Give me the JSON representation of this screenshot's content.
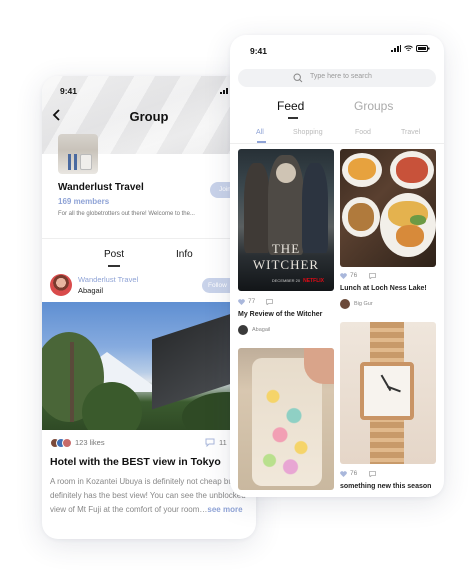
{
  "group_screen": {
    "status_time": "9:41",
    "title": "Group",
    "group_name": "Wanderlust Travel",
    "members": "169 members",
    "description": "For all the globetrotters out there! Welcome to the...",
    "join_label": "Join",
    "tabs": [
      {
        "label": "Post"
      },
      {
        "label": "Info"
      }
    ],
    "post": {
      "group": "Wanderlust Travel",
      "author": "Abagail",
      "follow_label": "Follow",
      "likes": "123 likes",
      "comments": "11",
      "title": "Hotel with the BEST view in Tokyo",
      "body": "A room in Kozantei Ubuya is definitely not cheap but it definitely has the best view! You can see the unblocked view of Mt Fuji at the comfort of your room…",
      "see_more": "see more"
    }
  },
  "feed_screen": {
    "status_time": "9:41",
    "search_placeholder": "Type here to search",
    "tabs": [
      {
        "label": "Feed"
      },
      {
        "label": "Groups"
      }
    ],
    "categories": [
      "All",
      "Shopping",
      "Food",
      "Travel"
    ],
    "cards": [
      {
        "likes": "77",
        "title": "My Review of the Witcher",
        "author": "Abagail",
        "image_text": "THE WITCHER",
        "image_subtext": "DECEMBER 20",
        "image_brand": "NETFLIX"
      },
      {
        "likes": "76",
        "title": "Lunch at Loch Ness Lake!",
        "author": "Big Gur"
      },
      {
        "likes": "",
        "title": "",
        "author": ""
      },
      {
        "likes": "76",
        "title": "something new this season",
        "author": ""
      }
    ]
  },
  "colors": {
    "accent": "#8fa3d6",
    "button_bg": "#c9d3ea"
  }
}
